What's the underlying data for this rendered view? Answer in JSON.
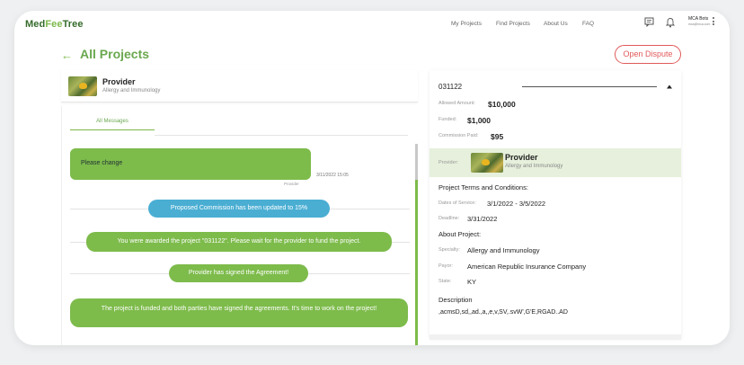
{
  "header": {
    "logo_part1": "Med",
    "logo_part2": "Fee",
    "logo_part3": "Tree",
    "nav": [
      "My Projects",
      "Find Projects",
      "About Us",
      "FAQ"
    ],
    "user_name": "MCA Bots",
    "user_sub": "mca@mca.com"
  },
  "page": {
    "back_icon": "←",
    "title": "All Projects",
    "dispute_button": "Open Dispute"
  },
  "provider_card": {
    "name": "Provider",
    "specialty": "Allergy and Immunology"
  },
  "chat": {
    "tab_label": "All Messages",
    "message": {
      "text": "Please change",
      "time": "3/11/2022 15:05",
      "sender": "Provider"
    },
    "events": [
      "Proposed Commission has been updated to 15%",
      "You were awarded the project \"031122\". Please wait for the provider to fund the project.",
      "Provider has signed the Agreement!",
      "The project is funded and both parties have signed the agreements. It's time to work on the project!"
    ]
  },
  "details": {
    "project_id": "031122",
    "allowed_amount_label": "Allowed Amount:",
    "allowed_amount": "$10,000",
    "funded_label": "Funded:",
    "funded": "$1,000",
    "commission_label": "Commission Paid:",
    "commission": "$95",
    "provider_label": "Provider:",
    "provider_name": "Provider",
    "provider_specialty": "Allergy and Immunology",
    "terms_heading": "Project Terms and Conditions:",
    "dates_label": "Dates of Service:",
    "dates": "3/1/2022 - 3/5/2022",
    "deadline_label": "Deadline:",
    "deadline": "3/31/2022",
    "about_heading": "About Project:",
    "specialty_label": "Specialty:",
    "specialty": "Allergy and Immunology",
    "payor_label": "Payor:",
    "payor": "American Republic Insurance Company",
    "state_label": "State:",
    "state": "KY",
    "description_heading": "Description",
    "description": ",acmsD,sd,,ad.,a,,e,v,SV,.svW',G'E,RGAD..AD"
  },
  "colors": {
    "brand_green": "#7dbb4b",
    "title_green": "#6aa84f",
    "info_blue": "#4aaed3",
    "dispute_red": "#e05a5a"
  },
  "icons": [
    "back-arrow-icon",
    "chat-icon",
    "bell-icon",
    "kebab-menu-icon",
    "collapse-caret-icon"
  ]
}
